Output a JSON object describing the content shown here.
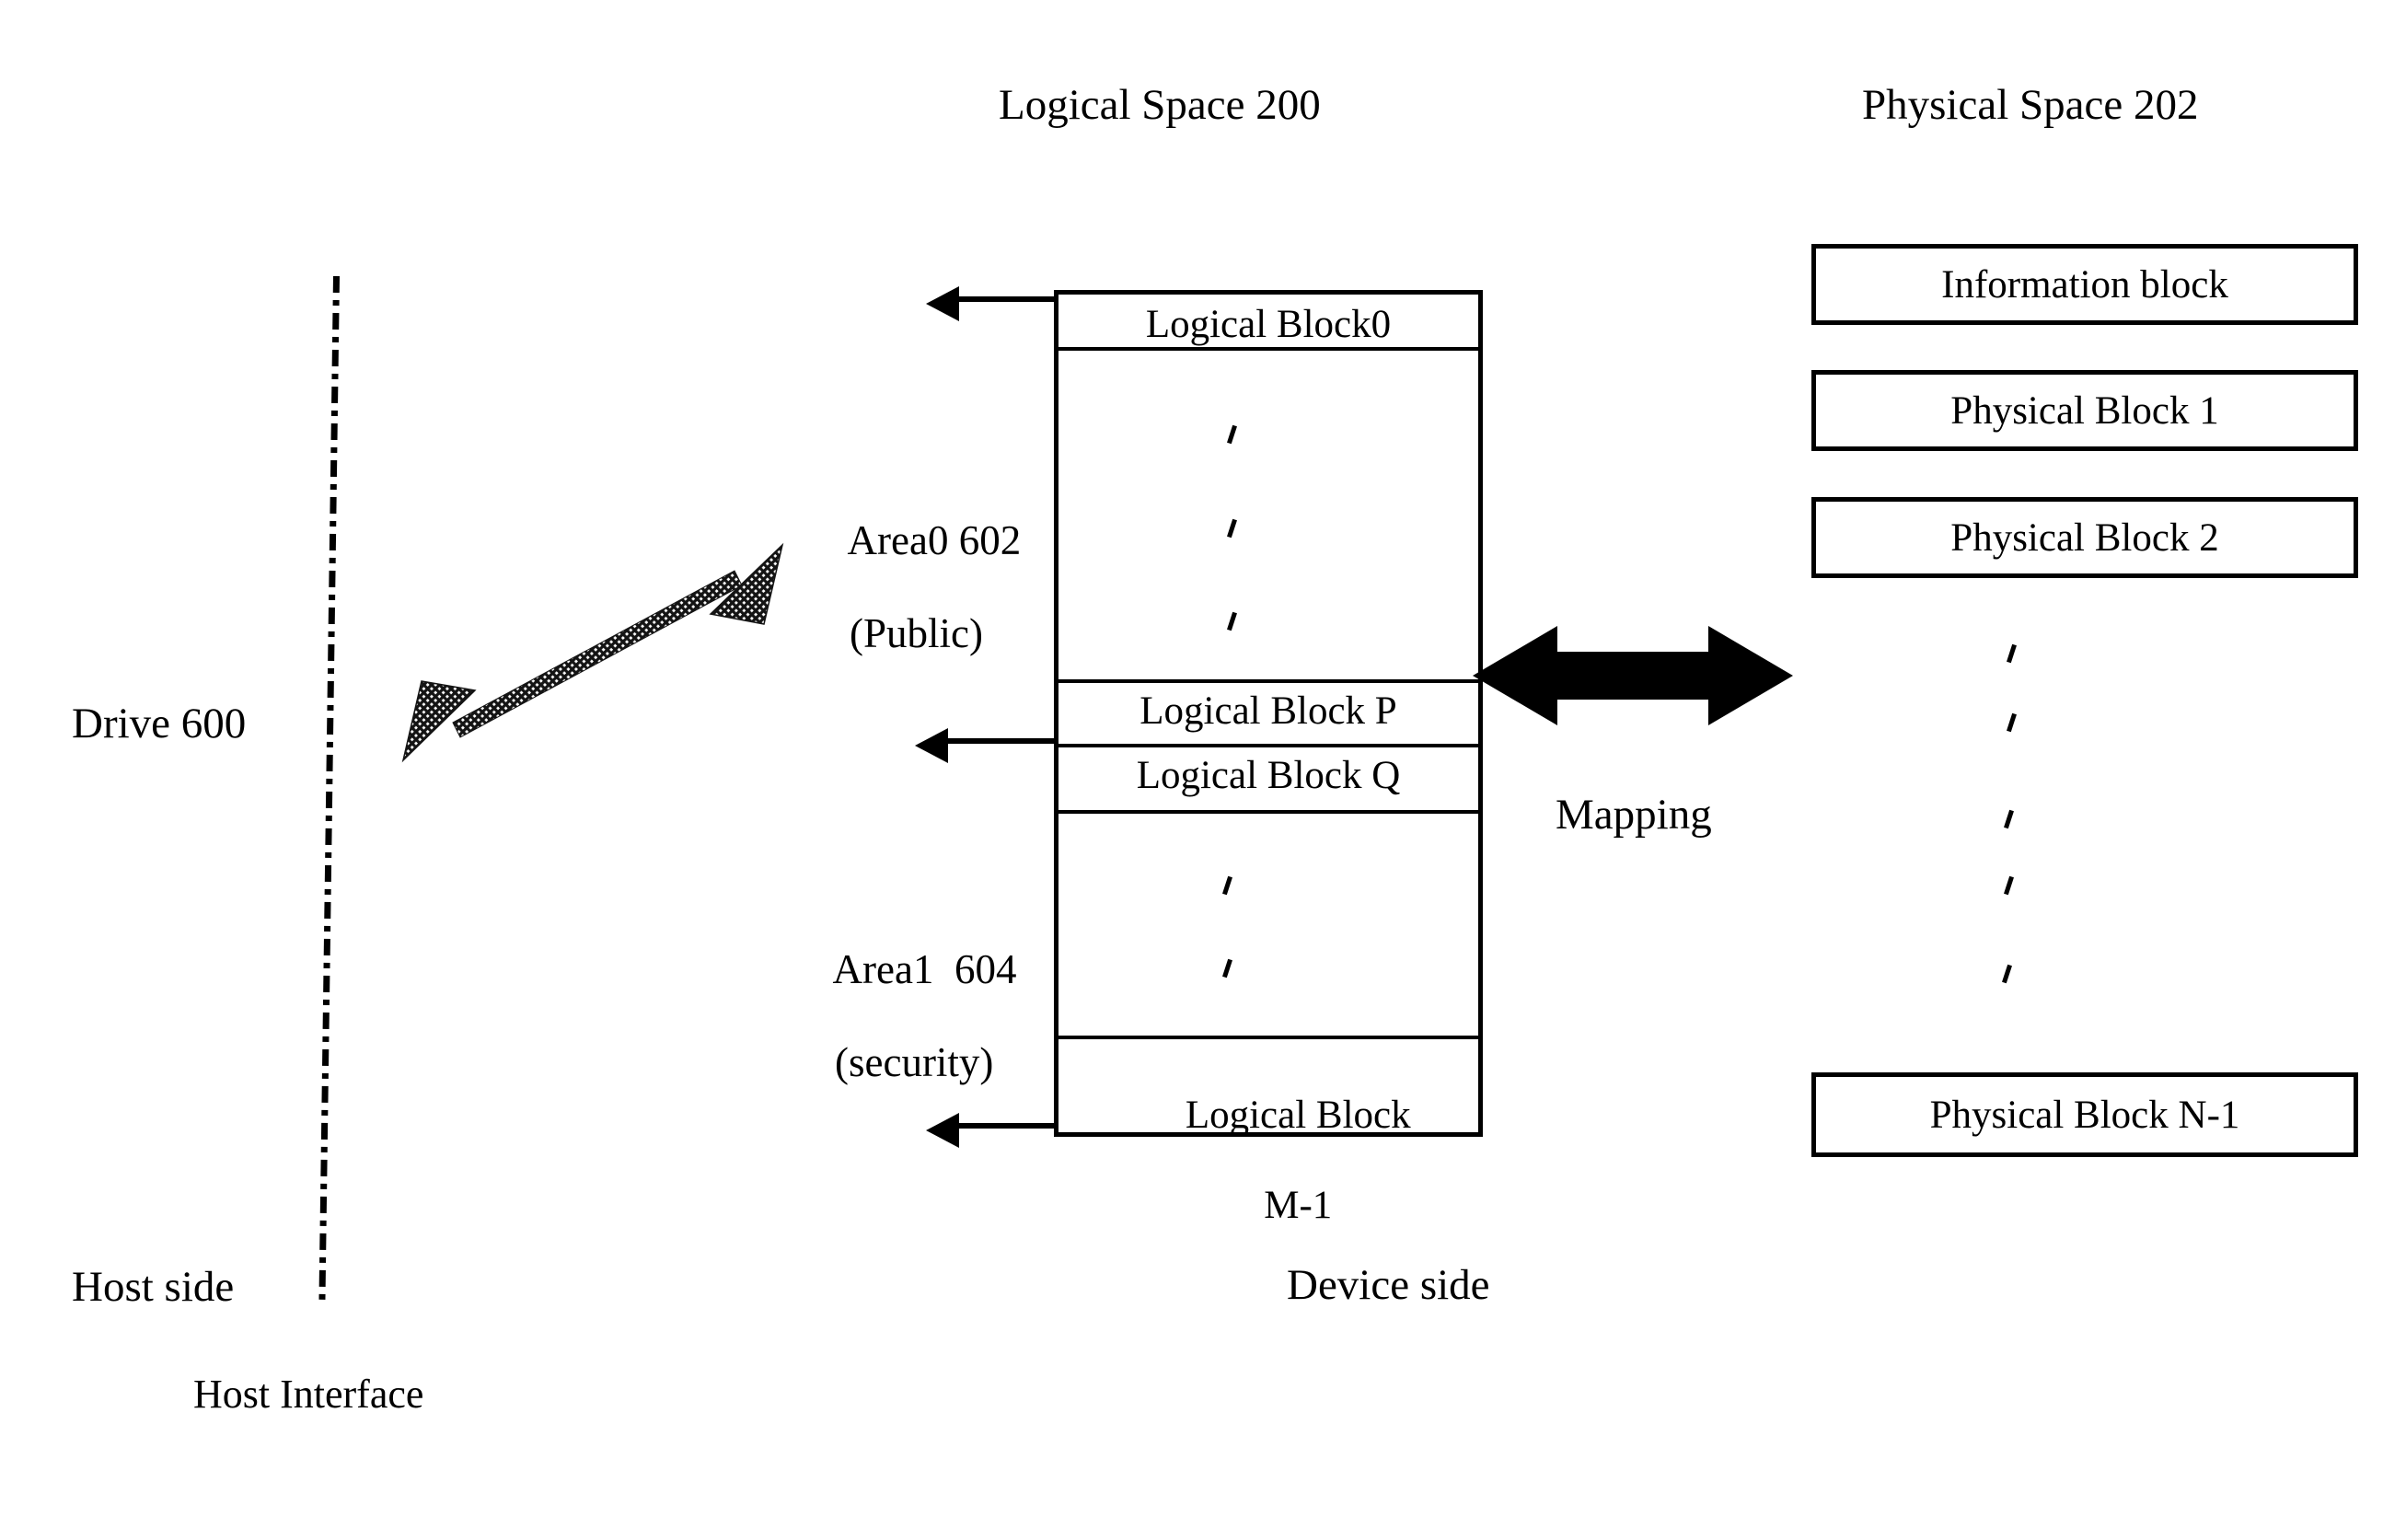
{
  "figure": {
    "logical_space_title": "Logical Space 200",
    "physical_space_title": "Physical Space 202",
    "drive_label": "Drive 600",
    "host_side_label": "Host side",
    "host_interface_label": "Host Interface",
    "device_side_label": "Device side",
    "mapping_label": "Mapping"
  },
  "areas": {
    "area0": {
      "line1": "Area0 602",
      "line2": "(Public)"
    },
    "area1": {
      "line1": "Area1  604",
      "line2": "(security)"
    }
  },
  "logical_blocks": [
    {
      "label": "Logical Block0"
    },
    {
      "label": "Logical Block P"
    },
    {
      "label": "Logical Block Q"
    },
    {
      "label_line1": "Logical Block",
      "label_line2": "M-1"
    }
  ],
  "physical_blocks": [
    {
      "label": "Information block"
    },
    {
      "label": "Physical Block 1"
    },
    {
      "label": "Physical Block 2"
    },
    {
      "label": "Physical Block N-1"
    }
  ],
  "colors": {
    "ink": "#000000",
    "paper": "#ffffff",
    "hatch": "#333333"
  }
}
